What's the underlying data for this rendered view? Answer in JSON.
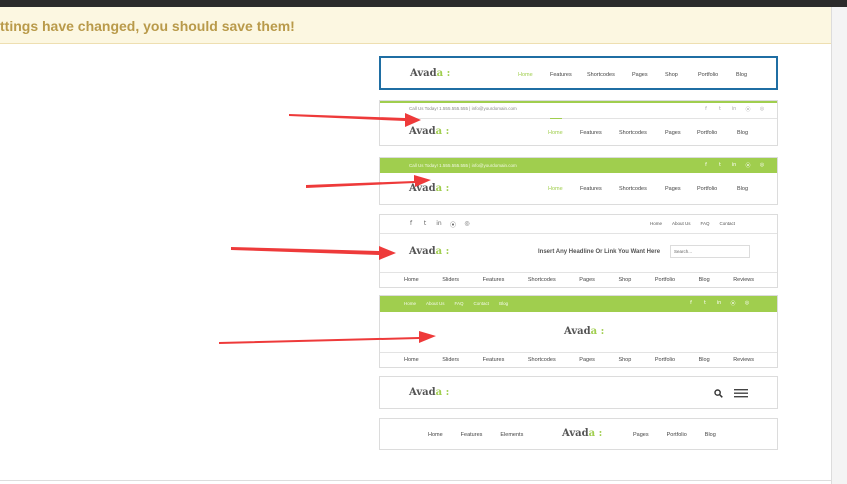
{
  "notice": {
    "text": "ttings have changed, you should save them!"
  },
  "brand": {
    "logo_main": "Avad",
    "logo_accent": "a :"
  },
  "colors": {
    "accent": "#a0ce4e",
    "selected_border": "#1f6ea3",
    "arrow": "#ee3a3a",
    "notice_text": "#b99a4a"
  },
  "h1": {
    "nav": [
      "Home",
      "Features",
      "Shortcodes",
      "Pages",
      "Shop",
      "Portfolio",
      "Blog"
    ]
  },
  "h2": {
    "contact": "Call Us Today! 1.555.555.555 | info@yourdomain.com",
    "nav": [
      "Home",
      "Features",
      "Shortcodes",
      "Pages",
      "Portfolio",
      "Blog"
    ]
  },
  "h3": {
    "contact": "Call Us Today! 1.555.555.555 | info@yourdomain.com",
    "nav": [
      "Home",
      "Features",
      "Shortcodes",
      "Pages",
      "Portfolio",
      "Blog"
    ]
  },
  "h4": {
    "topnav": [
      "Home",
      "About Us",
      "FAQ",
      "Contact"
    ],
    "headline": "Insert Any Headline Or Link You Want Here",
    "search_placeholder": "Search...",
    "nav": [
      "Home",
      "Sliders",
      "Features",
      "Shortcodes",
      "Pages",
      "Shop",
      "Portfolio",
      "Blog",
      "Reviews"
    ]
  },
  "h5": {
    "topnav": [
      "Home",
      "About Us",
      "FAQ",
      "Contact",
      "Blog"
    ],
    "nav": [
      "Home",
      "Sliders",
      "Features",
      "Shortcodes",
      "Pages",
      "Shop",
      "Portfolio",
      "Blog",
      "Reviews"
    ]
  },
  "h7": {
    "nav_left": [
      "Home",
      "Features",
      "Elements"
    ],
    "nav_right": [
      "Pages",
      "Portfolio",
      "Blog"
    ]
  },
  "icons": {
    "social": [
      "f",
      "t",
      "in",
      "rss",
      "dribbble"
    ],
    "search": "search-icon",
    "menu": "hamburger-icon"
  }
}
